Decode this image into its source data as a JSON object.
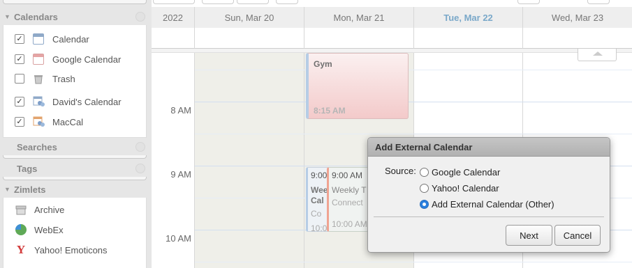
{
  "sidebar": {
    "calendars_header": "Calendars",
    "calendars": [
      {
        "label": "Calendar",
        "checked": true,
        "icon": "calendar-icon"
      },
      {
        "label": "Google Calendar",
        "checked": true,
        "icon": "calendar-icon"
      },
      {
        "label": "Trash",
        "checked": false,
        "icon": "trash-icon"
      },
      {
        "label": "David's Calendar",
        "checked": true,
        "icon": "shared-calendar-icon"
      },
      {
        "label": "MacCal",
        "checked": true,
        "icon": "shared-calendar-icon"
      }
    ],
    "searches_header": "Searches",
    "tags_header": "Tags",
    "zimlets_header": "Zimlets",
    "zimlets": [
      {
        "label": "Archive",
        "icon": "archive-icon"
      },
      {
        "label": "WebEx",
        "icon": "webex-icon"
      },
      {
        "label": "Yahoo! Emoticons",
        "icon": "yahoo-icon"
      }
    ],
    "check_mark": "✓"
  },
  "calendar": {
    "year": "2022",
    "days": [
      "Sun, Mar 20",
      "Mon, Mar 21",
      "Tue, Mar 22",
      "Wed, Mar 23"
    ],
    "today_index": 2,
    "times": [
      "8 AM",
      "9 AM",
      "10 AM"
    ],
    "events": {
      "gym": {
        "title": "Gym",
        "time": "8:15 AM"
      },
      "ev_left": {
        "time": "9:00",
        "line1": "Wee",
        "line2": "Cal",
        "line3": "Co",
        "line4": "10:0"
      },
      "ev_right": {
        "time": "9:00 AM",
        "line1": "Weekly T",
        "line2": "Connect",
        "line3": "10:00 AM"
      }
    }
  },
  "dialog": {
    "title": "Add External Calendar",
    "source_label": "Source:",
    "options": [
      "Google Calendar",
      "Yahoo! Calendar",
      "Add External Calendar (Other)"
    ],
    "selected_index": 2,
    "next_button": "Next",
    "cancel_button": "Cancel"
  },
  "colors": {
    "today": "#7aa8c9",
    "selected_radio": "#2a7fdd",
    "gym_event": "#f3caca"
  }
}
